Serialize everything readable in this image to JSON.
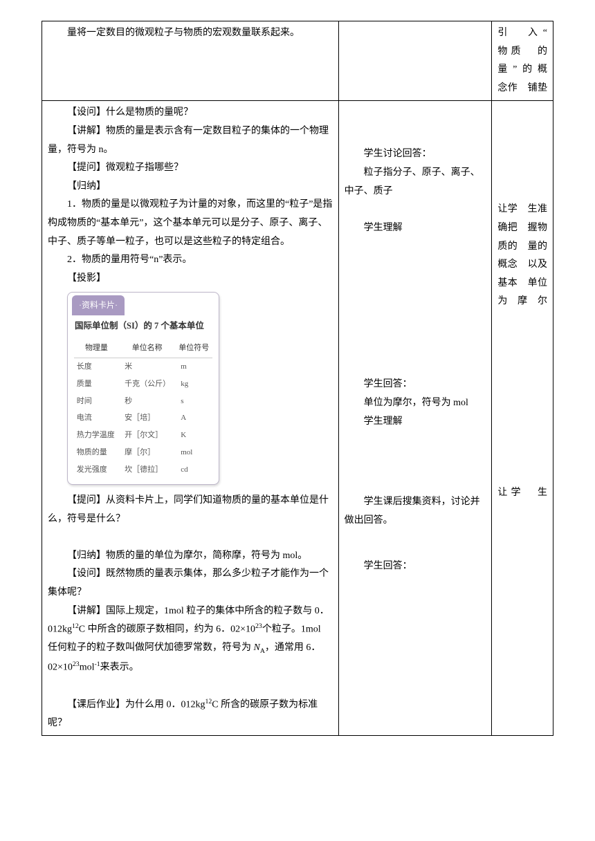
{
  "row1": {
    "col1_p1": "量将一定数目的微观粒子与物质的宏观数量联系起来。",
    "col3": "引　入“　物质　的量”的概　念作　铺垫"
  },
  "row2": {
    "col1": {
      "p1": "【设问】什么是物质的量呢？",
      "p2": "【讲解】物质的量是表示含有一定数目粒子的集体的一个物理量，符号为 n。",
      "p3": "【提问】微观粒子指哪些？",
      "p4": "【归纳】",
      "p5": "1．物质的量是以微观粒子为计量的对象，而这里的“粒子”是指构成物质的“基本单元”，这个基本单元可以是分子、原子、离子、中子、质子等单一粒子，也可以是这些粒子的特定组合。",
      "p6": "2．物质的量用符号“n”表示。",
      "p7": "【投影】",
      "p8": "【提问】从资料卡片上，同学们知道物质的量的基本单位是什么，符号是什么？",
      "p9": "【归纳】物质的量的单位为摩尔，简称摩，符号为 mol。",
      "p10": "【设问】既然物质的量表示集体，那么多少粒子才能作为一个集体呢？",
      "p11_a": "【讲解】国际上规定，1mol 粒子的集体中所含的粒子数与 0．012kg",
      "p11_b": "C 中所含的碳原子数相同，约为 6．02×10",
      "p11_c": "个粒子。1mol 任何粒子的粒子数叫做阿伏加德罗常数，符号为 ",
      "p11_d": "，通常用 6．02×10",
      "p11_e": "mol",
      "p11_f": "来表示。",
      "p12_a": "【课后作业】为什么用 0．012kg",
      "p12_b": "C 所含的碳原子数为标准呢？",
      "sup12": "12",
      "sup23": "23",
      "supNa": "N",
      "subA": "A",
      "supn1": "-1"
    },
    "col2": {
      "b1": "学生讨论回答：",
      "b2": "粒子指分子、原子、离子、中子、质子",
      "b3": "学生理解",
      "b4": "学生回答：",
      "b5": "单位为摩尔，符号为 mol",
      "b6": "学生理解",
      "b7": "学生课后搜集资料，讨论并做出回答。",
      "b8": "学生回答："
    },
    "col3a": "让学　生准　确把　握物　质的　量的　概念　以及　基本　单位　为摩尔",
    "col3b": "让学　生"
  },
  "card": {
    "tab": "·资料卡片·",
    "title": "国际单位制（SI）的 7 个基本单位",
    "head": [
      "物理量",
      "单位名称",
      "单位符号"
    ],
    "rows": [
      [
        "长度",
        "米",
        "m"
      ],
      [
        "质量",
        "千克（公斤）",
        "kg"
      ],
      [
        "时间",
        "秒",
        "s"
      ],
      [
        "电流",
        "安［培］",
        "A"
      ],
      [
        "热力学温度",
        "开［尔文］",
        "K"
      ],
      [
        "物质的量",
        "摩［尔］",
        "mol"
      ],
      [
        "发光强度",
        "坎［德拉］",
        "cd"
      ]
    ]
  }
}
